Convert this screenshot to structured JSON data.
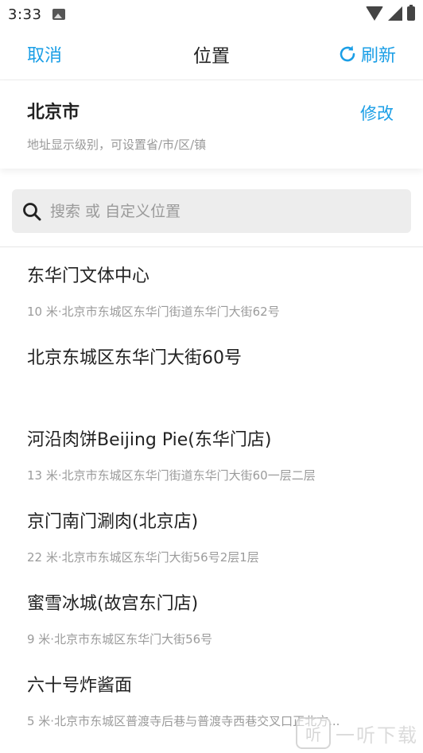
{
  "status_bar": {
    "time": "3:33",
    "icons": [
      "photo-icon",
      "wifi-icon",
      "signal-icon",
      "battery-icon"
    ]
  },
  "header": {
    "cancel_label": "取消",
    "title": "位置",
    "refresh_label": "刷新",
    "accent_color": "#1a9ee6"
  },
  "current_location": {
    "city": "北京市",
    "hint": "地址显示级别，可设置省/市/区/镇",
    "edit_label": "修改"
  },
  "search": {
    "placeholder": "搜索 或 自定义位置"
  },
  "places": [
    {
      "name": "东华门文体中心",
      "address": "10 米·北京市东城区东华门街道东华门大街62号"
    },
    {
      "name": "北京东城区东华门大街60号",
      "address": ""
    },
    {
      "name": "河沿肉饼Beijing Pie(东华门店)",
      "address": "13 米·北京市东城区东华门街道东华门大街60一层二层"
    },
    {
      "name": "京门南门涮肉(北京店)",
      "address": "22 米·北京市东城区东华门大街56号2层1层"
    },
    {
      "name": "蜜雪冰城(故宫东门店)",
      "address": "9 米·北京市东城区东华门大街56号"
    },
    {
      "name": "六十号炸酱面",
      "address": "5 米·北京市东城区普渡寺后巷与普渡寺西巷交叉口正北方..."
    }
  ],
  "watermark": {
    "logo_text": "听",
    "text": "一听下载"
  }
}
